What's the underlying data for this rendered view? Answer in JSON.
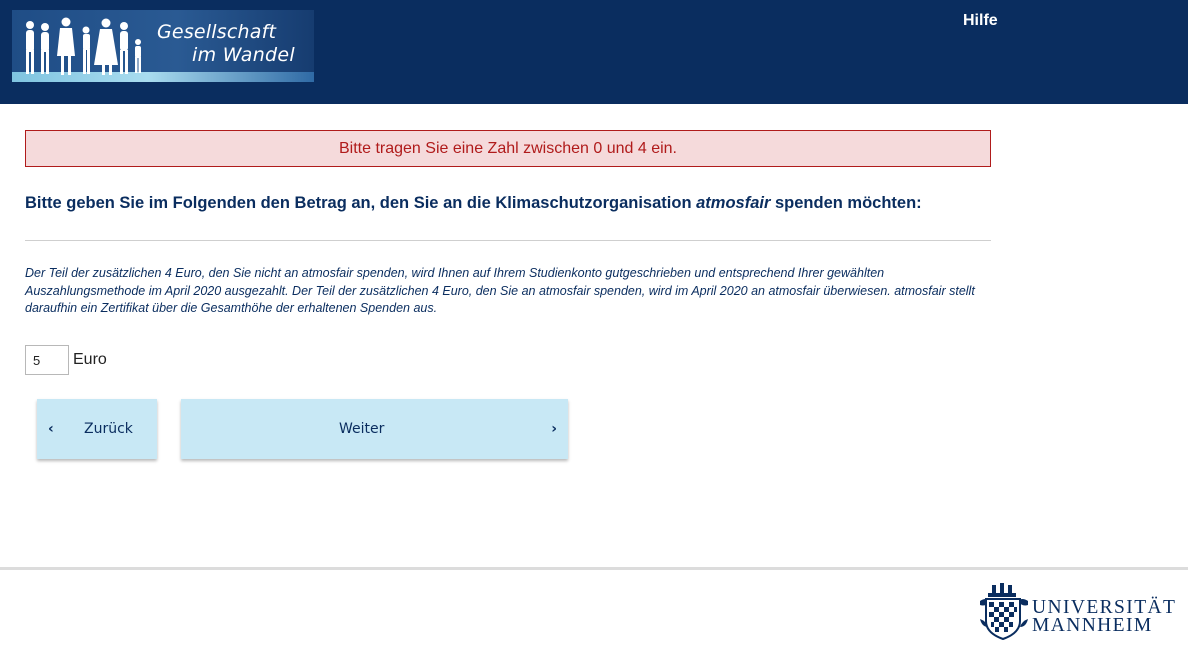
{
  "header": {
    "logo_line1": "Gesellschaft",
    "logo_line2": "im Wandel",
    "help_link": "Hilfe",
    "background_color": "#0a2d5f"
  },
  "main": {
    "error_message": "Bitte tragen Sie eine Zahl zwischen 0 und 4 ein.",
    "question_before": "Bitte geben Sie im Folgenden den Betrag an, den Sie an die Klimaschutzorganisation ",
    "question_emphasis": "atmosfair",
    "question_after": " spenden möchten:",
    "info_text": "Der Teil der zusätzlichen 4 Euro, den Sie nicht an atmosfair spenden, wird Ihnen auf Ihrem Studienkonto gutgeschrieben und entsprechend Ihrer gewählten Auszahlungsmethode im April 2020 ausgezahlt. Der Teil der zusätzlichen 4 Euro, den Sie an atmosfair spenden, wird im April 2020 an atmosfair überwiesen. atmosfair stellt daraufhin ein Zertifikat über die Gesamthöhe der erhaltenen Spenden aus.",
    "amount_value": "5",
    "amount_unit": "Euro"
  },
  "navigation": {
    "back_label": "Zurück",
    "back_icon": "chevron-left-icon",
    "next_label": "Weiter",
    "next_icon": "chevron-right-icon",
    "button_color": "#c8e8f5"
  },
  "footer": {
    "university_line1": "UNIVERSITÄT",
    "university_line2": "MANNHEIM"
  },
  "colors": {
    "error_text": "#b01b1b",
    "error_background": "#f5dadb",
    "text_primary": "#0a2d5f"
  }
}
